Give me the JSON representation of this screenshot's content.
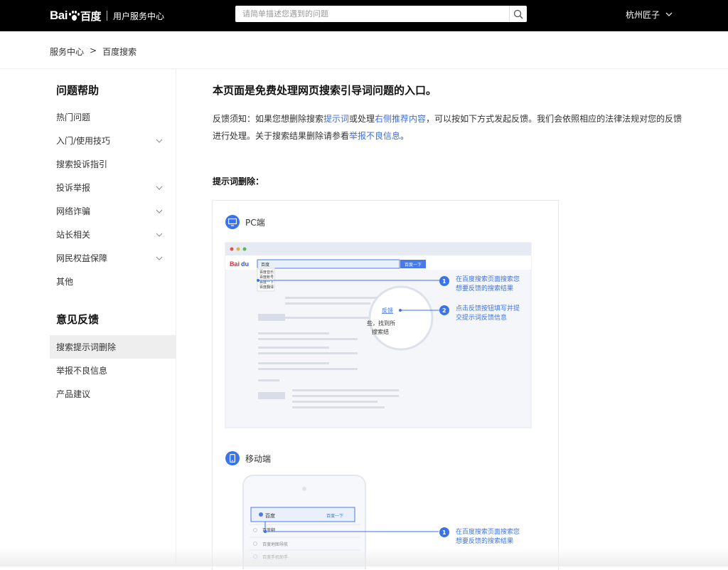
{
  "header": {
    "logo_left": "Bai",
    "logo_right": "百度",
    "logo_du": "du",
    "subtitle": "用户服务中心",
    "search_placeholder": "请简单描述您遇到的问题",
    "user_name": "杭州匠子"
  },
  "breadcrumb": {
    "items": [
      "服务中心",
      "百度搜索"
    ],
    "separator": ">"
  },
  "sidebar": {
    "section1_title": "问题帮助",
    "section1_items": [
      {
        "label": "热门问题"
      },
      {
        "label": "入门/使用技巧"
      },
      {
        "label": "搜索投诉指引"
      },
      {
        "label": "投诉举报"
      },
      {
        "label": "网络诈骗"
      },
      {
        "label": "站长相关"
      },
      {
        "label": "网民权益保障"
      },
      {
        "label": "其他"
      }
    ],
    "section2_title": "意见反馈",
    "section2_items": [
      {
        "label": "搜索提示词删除"
      },
      {
        "label": "举报不良信息"
      },
      {
        "label": "产品建议"
      }
    ]
  },
  "main": {
    "title": "本页面是免费处理网页搜索引导词问题的入口。",
    "notice_prefix": "反馈须知：如果您想删除搜索",
    "notice_link1": "提示词",
    "notice_mid1": "或处理",
    "notice_link2": "右侧推荐内容",
    "notice_mid2": "，可以按如下方式发起反馈。我们会依照相应的法律法规对您的反馈进行处理。关于搜索结果删除请参看",
    "notice_link3": "举报不良信息",
    "notice_suffix": "。",
    "section_label": "提示词删除：",
    "pc_label": "PC端",
    "mobile_label": "移动端",
    "pc_step1": "在百度搜索页面搜索您想要反馈的搜索结果",
    "pc_step2": "点击反馈按钮填写并提交提示词反馈信息",
    "mobile_step1": "在百度搜索页面搜索您想要反馈的搜索结果",
    "step1_num": "1",
    "step2_num": "2",
    "mock_feedback": "反馈",
    "mock_find": "些，找到所",
    "mock_result": "搜索结",
    "mock_baidu_btn": "百度一下",
    "mock_mobile_baidu": "百度",
    "mock_input": "百度",
    "mock_suggestions": [
      "百度音乐",
      "百度账号",
      "百度一下",
      "百度翻译"
    ],
    "mock_mobile_suggestions": [
      "百度翻",
      "百度地图导航",
      "百度手机助手"
    ]
  },
  "colors": {
    "accent": "#3b73e8",
    "link": "#3f6fd9",
    "topbar": "#000000"
  }
}
